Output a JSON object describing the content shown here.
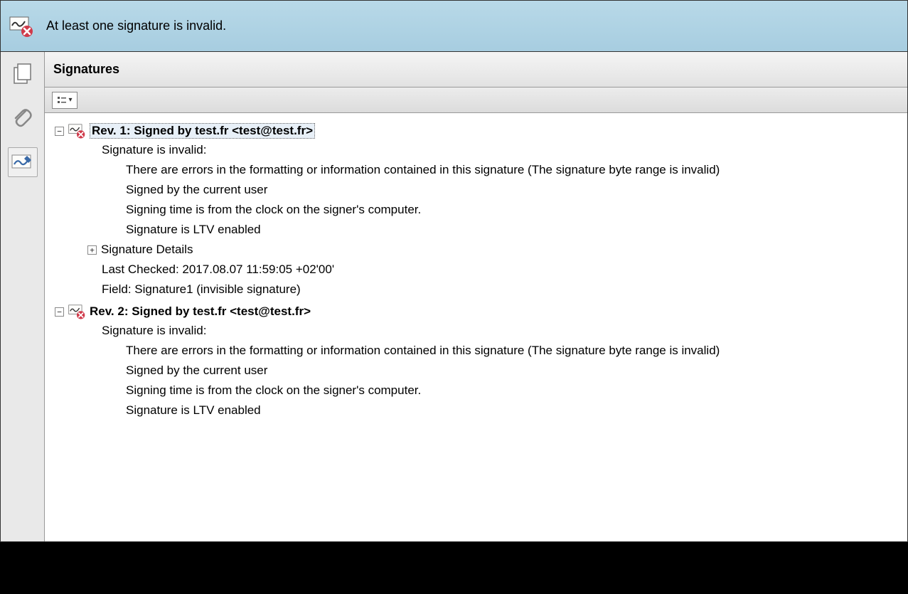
{
  "alert": {
    "message": "At least one signature is invalid."
  },
  "panel": {
    "title": "Signatures"
  },
  "signatures": [
    {
      "title": "Rev. 1: Signed by test.fr <test@test.fr>",
      "selected": true,
      "status": "Signature is invalid:",
      "messages": [
        "There are errors in the formatting or information contained in this signature (The signature byte range is invalid)",
        "Signed by the current user",
        "Signing time is from the clock on the signer's computer.",
        "Signature is LTV enabled"
      ],
      "details_label": "Signature Details",
      "last_checked_label": "Last Checked: 2017.08.07 11:59:05 +02'00'",
      "field_label": "Field: Signature1 (invisible signature)"
    },
    {
      "title": "Rev. 2: Signed by test.fr <test@test.fr>",
      "selected": false,
      "status": "Signature is invalid:",
      "messages": [
        "There are errors in the formatting or information contained in this signature (The signature byte range is invalid)",
        "Signed by the current user",
        "Signing time is from the clock on the signer's computer.",
        "Signature is LTV enabled"
      ]
    }
  ],
  "icons": {
    "expand": "+",
    "collapse": "−",
    "dropdown": "▾"
  }
}
